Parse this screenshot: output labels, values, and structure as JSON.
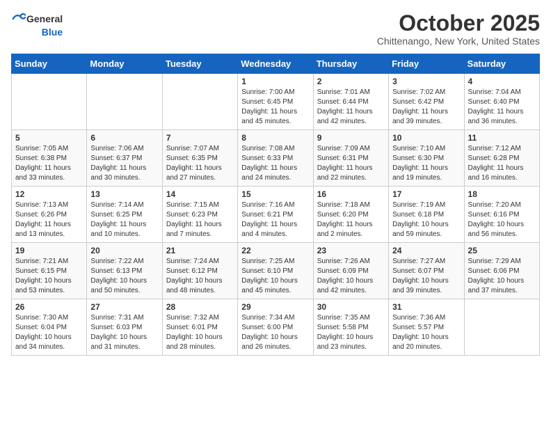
{
  "header": {
    "logo": {
      "general": "General",
      "blue": "Blue"
    },
    "title": "October 2025",
    "location": "Chittenango, New York, United States"
  },
  "weekdays": [
    "Sunday",
    "Monday",
    "Tuesday",
    "Wednesday",
    "Thursday",
    "Friday",
    "Saturday"
  ],
  "weeks": [
    [
      {
        "day": "",
        "info": ""
      },
      {
        "day": "",
        "info": ""
      },
      {
        "day": "",
        "info": ""
      },
      {
        "day": "1",
        "info": "Sunrise: 7:00 AM\nSunset: 6:45 PM\nDaylight: 11 hours and 45 minutes."
      },
      {
        "day": "2",
        "info": "Sunrise: 7:01 AM\nSunset: 6:44 PM\nDaylight: 11 hours and 42 minutes."
      },
      {
        "day": "3",
        "info": "Sunrise: 7:02 AM\nSunset: 6:42 PM\nDaylight: 11 hours and 39 minutes."
      },
      {
        "day": "4",
        "info": "Sunrise: 7:04 AM\nSunset: 6:40 PM\nDaylight: 11 hours and 36 minutes."
      }
    ],
    [
      {
        "day": "5",
        "info": "Sunrise: 7:05 AM\nSunset: 6:38 PM\nDaylight: 11 hours and 33 minutes."
      },
      {
        "day": "6",
        "info": "Sunrise: 7:06 AM\nSunset: 6:37 PM\nDaylight: 11 hours and 30 minutes."
      },
      {
        "day": "7",
        "info": "Sunrise: 7:07 AM\nSunset: 6:35 PM\nDaylight: 11 hours and 27 minutes."
      },
      {
        "day": "8",
        "info": "Sunrise: 7:08 AM\nSunset: 6:33 PM\nDaylight: 11 hours and 24 minutes."
      },
      {
        "day": "9",
        "info": "Sunrise: 7:09 AM\nSunset: 6:31 PM\nDaylight: 11 hours and 22 minutes."
      },
      {
        "day": "10",
        "info": "Sunrise: 7:10 AM\nSunset: 6:30 PM\nDaylight: 11 hours and 19 minutes."
      },
      {
        "day": "11",
        "info": "Sunrise: 7:12 AM\nSunset: 6:28 PM\nDaylight: 11 hours and 16 minutes."
      }
    ],
    [
      {
        "day": "12",
        "info": "Sunrise: 7:13 AM\nSunset: 6:26 PM\nDaylight: 11 hours and 13 minutes."
      },
      {
        "day": "13",
        "info": "Sunrise: 7:14 AM\nSunset: 6:25 PM\nDaylight: 11 hours and 10 minutes."
      },
      {
        "day": "14",
        "info": "Sunrise: 7:15 AM\nSunset: 6:23 PM\nDaylight: 11 hours and 7 minutes."
      },
      {
        "day": "15",
        "info": "Sunrise: 7:16 AM\nSunset: 6:21 PM\nDaylight: 11 hours and 4 minutes."
      },
      {
        "day": "16",
        "info": "Sunrise: 7:18 AM\nSunset: 6:20 PM\nDaylight: 11 hours and 2 minutes."
      },
      {
        "day": "17",
        "info": "Sunrise: 7:19 AM\nSunset: 6:18 PM\nDaylight: 10 hours and 59 minutes."
      },
      {
        "day": "18",
        "info": "Sunrise: 7:20 AM\nSunset: 6:16 PM\nDaylight: 10 hours and 56 minutes."
      }
    ],
    [
      {
        "day": "19",
        "info": "Sunrise: 7:21 AM\nSunset: 6:15 PM\nDaylight: 10 hours and 53 minutes."
      },
      {
        "day": "20",
        "info": "Sunrise: 7:22 AM\nSunset: 6:13 PM\nDaylight: 10 hours and 50 minutes."
      },
      {
        "day": "21",
        "info": "Sunrise: 7:24 AM\nSunset: 6:12 PM\nDaylight: 10 hours and 48 minutes."
      },
      {
        "day": "22",
        "info": "Sunrise: 7:25 AM\nSunset: 6:10 PM\nDaylight: 10 hours and 45 minutes."
      },
      {
        "day": "23",
        "info": "Sunrise: 7:26 AM\nSunset: 6:09 PM\nDaylight: 10 hours and 42 minutes."
      },
      {
        "day": "24",
        "info": "Sunrise: 7:27 AM\nSunset: 6:07 PM\nDaylight: 10 hours and 39 minutes."
      },
      {
        "day": "25",
        "info": "Sunrise: 7:29 AM\nSunset: 6:06 PM\nDaylight: 10 hours and 37 minutes."
      }
    ],
    [
      {
        "day": "26",
        "info": "Sunrise: 7:30 AM\nSunset: 6:04 PM\nDaylight: 10 hours and 34 minutes."
      },
      {
        "day": "27",
        "info": "Sunrise: 7:31 AM\nSunset: 6:03 PM\nDaylight: 10 hours and 31 minutes."
      },
      {
        "day": "28",
        "info": "Sunrise: 7:32 AM\nSunset: 6:01 PM\nDaylight: 10 hours and 28 minutes."
      },
      {
        "day": "29",
        "info": "Sunrise: 7:34 AM\nSunset: 6:00 PM\nDaylight: 10 hours and 26 minutes."
      },
      {
        "day": "30",
        "info": "Sunrise: 7:35 AM\nSunset: 5:58 PM\nDaylight: 10 hours and 23 minutes."
      },
      {
        "day": "31",
        "info": "Sunrise: 7:36 AM\nSunset: 5:57 PM\nDaylight: 10 hours and 20 minutes."
      },
      {
        "day": "",
        "info": ""
      }
    ]
  ]
}
